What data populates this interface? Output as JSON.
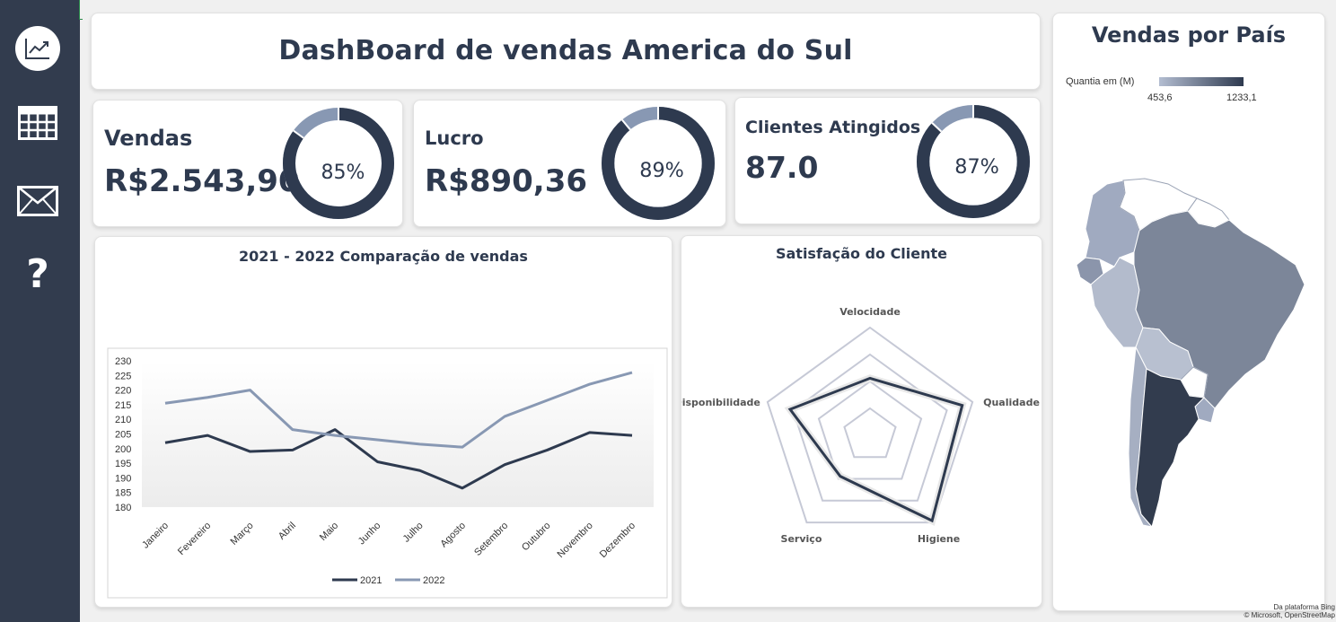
{
  "sidebar": {
    "items": [
      {
        "name": "chart-icon"
      },
      {
        "name": "table-icon"
      },
      {
        "name": "mail-icon"
      },
      {
        "name": "help-icon",
        "label": "?"
      }
    ]
  },
  "header": {
    "title": "DashBoard de vendas America do Sul"
  },
  "kpis": [
    {
      "label": "Vendas",
      "value": "R$2.543,90",
      "percent_label": "85%",
      "percent": 85
    },
    {
      "label": "Lucro",
      "value": "R$890,36",
      "percent_label": "89%",
      "percent": 89
    },
    {
      "label": "Clientes Atingidos",
      "value": "87.0",
      "percent_label": "87%",
      "percent": 87
    }
  ],
  "colors": {
    "dark": "#2e3a4f",
    "light": "#8898b3",
    "sidebar": "#323c4e"
  },
  "line_chart": {
    "title": "2021 - 2022 Comparação de vendas"
  },
  "radar_chart": {
    "title": "Satisfação do Cliente"
  },
  "map": {
    "title": "Vendas por País",
    "legend_label": "Quantia em (M)",
    "legend_min": "453,6",
    "legend_max": "1233,1",
    "attribution_line1": "Da plataforma Bing",
    "attribution_line2": "© Microsoft, OpenStreetMap"
  },
  "chart_data": [
    {
      "type": "line",
      "title": "2021 - 2022 Comparação de vendas",
      "categories": [
        "Janeiro",
        "Fevereiro",
        "Março",
        "Abril",
        "Maio",
        "Junho",
        "Julho",
        "Agosto",
        "Setembro",
        "Outubro",
        "Novembro",
        "Dezembro"
      ],
      "series": [
        {
          "name": "2021",
          "values": [
            202,
            204.5,
            199,
            199.5,
            206.5,
            195.5,
            192.5,
            186.5,
            194.5,
            199.5,
            205.5,
            204.5
          ]
        },
        {
          "name": "2022",
          "values": [
            215.5,
            217.5,
            220,
            206.5,
            204.5,
            203,
            201.5,
            200.5,
            211,
            216.5,
            222,
            226
          ]
        }
      ],
      "ylim": [
        180,
        230
      ],
      "yticks": [
        180,
        185,
        190,
        195,
        200,
        205,
        210,
        215,
        220,
        225,
        230
      ],
      "legend": "bottom"
    },
    {
      "type": "radar",
      "title": "Satisfação do Cliente",
      "categories": [
        "Velocidade",
        "Qualidade",
        "Higiene",
        "Serviço",
        "Disponibilidade"
      ],
      "values": [
        0.53,
        0.9,
        0.98,
        0.47,
        0.78
      ],
      "grid_levels": 4
    }
  ]
}
